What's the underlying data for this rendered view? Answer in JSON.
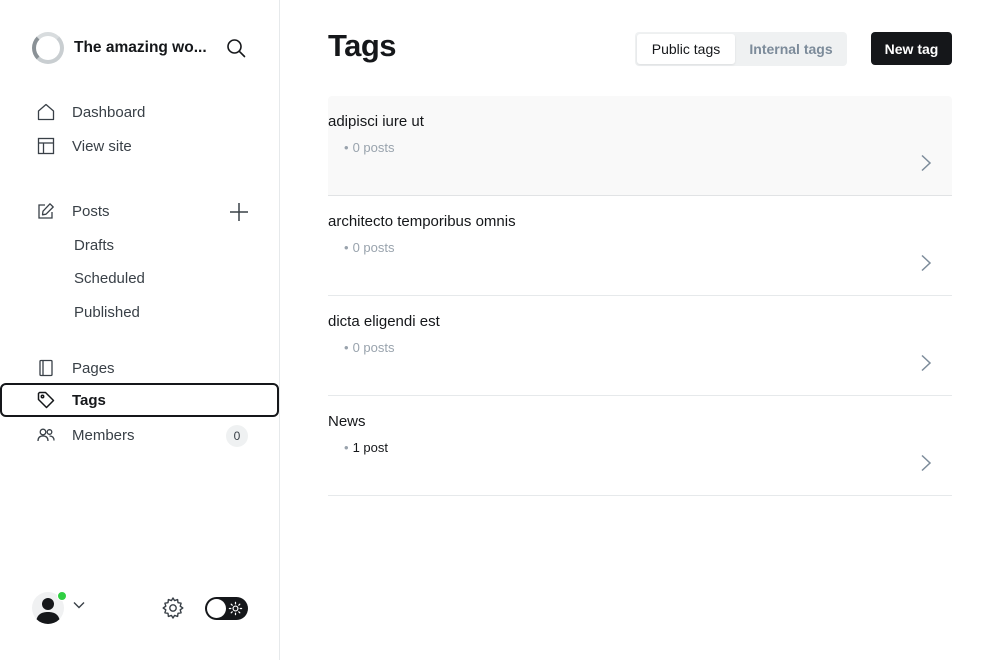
{
  "site": {
    "title": "The amazing wo..."
  },
  "nav": {
    "dashboard": "Dashboard",
    "view_site": "View site",
    "posts": "Posts",
    "drafts": "Drafts",
    "scheduled": "Scheduled",
    "published": "Published",
    "pages": "Pages",
    "tags": "Tags",
    "members": "Members",
    "members_count": "0"
  },
  "header": {
    "title": "Tags",
    "public_tab": "Public tags",
    "internal_tab": "Internal tags",
    "new_button": "New tag"
  },
  "tags": [
    {
      "name": "adipisci iure ut",
      "count": "0 posts"
    },
    {
      "name": "architecto temporibus omnis",
      "count": "0 posts"
    },
    {
      "name": "dicta eligendi est",
      "count": "0 posts"
    },
    {
      "name": "News",
      "count": "1 post"
    }
  ],
  "colors": {
    "accent": "#15171a",
    "online": "#30cf43",
    "muted": "#99a3ad"
  }
}
